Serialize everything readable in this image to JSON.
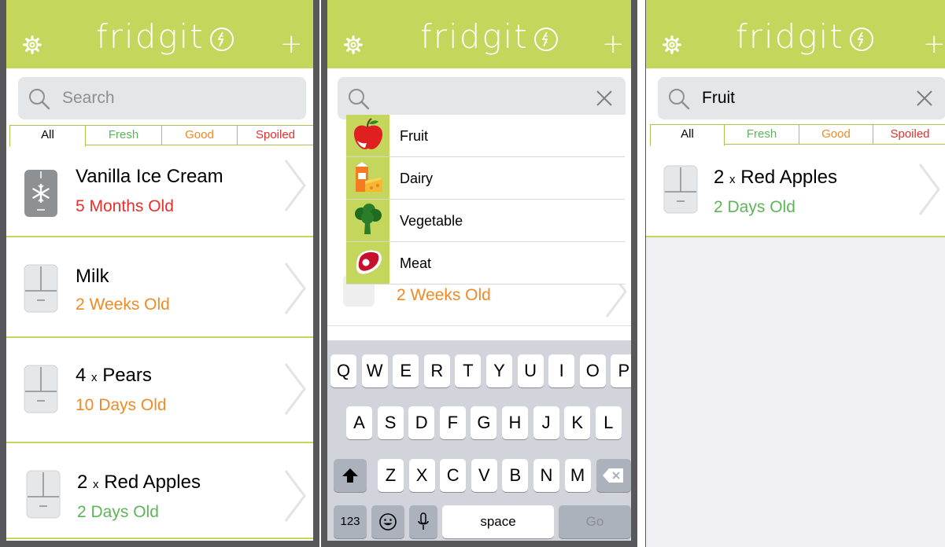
{
  "app": {
    "name": "fridgit"
  },
  "tabs": {
    "all": "All",
    "fresh": "Fresh",
    "good": "Good",
    "spoiled": "Spoiled"
  },
  "colors": {
    "header": "#c4d65c",
    "fresh": "#5db55a",
    "good": "#f08a24",
    "spoiled": "#e8302b"
  },
  "panel1": {
    "search_placeholder": "Search",
    "items": [
      {
        "icon": "freezer-icon",
        "quantity": "",
        "name": "Vanilla Ice Cream",
        "age": "5 Months Old",
        "status": "spoiled"
      },
      {
        "icon": "fridge-icon",
        "quantity": "",
        "name": "Milk",
        "age": "2 Weeks Old",
        "status": "good"
      },
      {
        "icon": "fridge-icon",
        "quantity": "4",
        "name": "Pears",
        "age": "10 Days Old",
        "status": "good"
      },
      {
        "icon": "fridge-icon",
        "quantity": "2",
        "name": "Red Apples",
        "age": "2 Days Old",
        "status": "fresh"
      }
    ]
  },
  "panel2": {
    "search_value": "",
    "categories": [
      {
        "icon": "apple-icon",
        "label": "Fruit"
      },
      {
        "icon": "dairy-icon",
        "label": "Dairy"
      },
      {
        "icon": "broccoli-icon",
        "label": "Vegetable"
      },
      {
        "icon": "steak-icon",
        "label": "Meat"
      }
    ],
    "peek_age": "2 Weeks Old",
    "keyboard": {
      "row1": [
        "Q",
        "W",
        "E",
        "R",
        "T",
        "Y",
        "U",
        "I",
        "O",
        "P"
      ],
      "row2": [
        "A",
        "S",
        "D",
        "F",
        "G",
        "H",
        "J",
        "K",
        "L"
      ],
      "row3": [
        "Z",
        "X",
        "C",
        "V",
        "B",
        "N",
        "M"
      ],
      "numbers": "123",
      "space": "space",
      "go": "Go"
    }
  },
  "panel3": {
    "search_value": "Fruit",
    "items": [
      {
        "icon": "fridge-icon",
        "quantity": "2",
        "name": "Red Apples",
        "age": "2 Days Old",
        "status": "fresh"
      }
    ]
  },
  "quantity_sep": "x"
}
